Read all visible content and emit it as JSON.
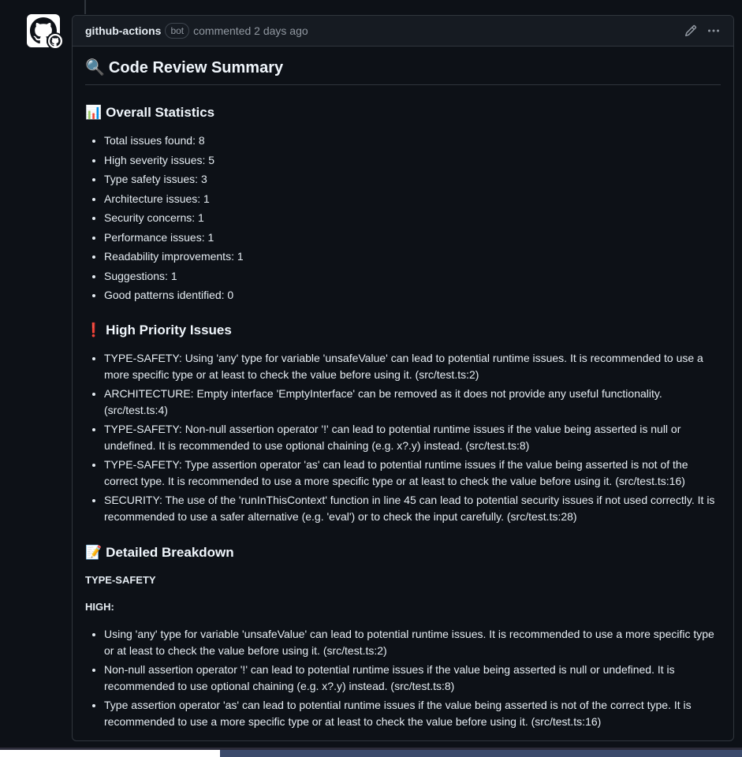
{
  "header": {
    "author": "github-actions",
    "bot_label": "bot",
    "meta": "commented 2 days ago"
  },
  "summary": {
    "title": "Code Review Summary",
    "title_icon": "🔍",
    "stats_heading": "Overall Statistics",
    "stats_icon": "📊",
    "stats": [
      "Total issues found: 8",
      "High severity issues: 5",
      "Type safety issues: 3",
      "Architecture issues: 1",
      "Security concerns: 1",
      "Performance issues: 1",
      "Readability improvements: 1",
      "Suggestions: 1",
      "Good patterns identified: 0"
    ],
    "priority_heading": "High Priority Issues",
    "priority_icon": "❗",
    "priority_issues": [
      "TYPE-SAFETY: Using 'any' type for variable 'unsafeValue' can lead to potential runtime issues. It is recommended to use a more specific type or at least to check the value before using it. (src/test.ts:2)",
      "ARCHITECTURE: Empty interface 'EmptyInterface' can be removed as it does not provide any useful functionality. (src/test.ts:4)",
      "TYPE-SAFETY: Non-null assertion operator '!' can lead to potential runtime issues if the value being asserted is null or undefined. It is recommended to use optional chaining (e.g. x?.y) instead. (src/test.ts:8)",
      "TYPE-SAFETY: Type assertion operator 'as' can lead to potential runtime issues if the value being asserted is not of the correct type. It is recommended to use a more specific type or at least to check the value before using it. (src/test.ts:16)",
      "SECURITY: The use of the 'runInThisContext' function in line 45 can lead to potential security issues if not used correctly. It is recommended to use a safer alternative (e.g. 'eval') or to check the input carefully. (src/test.ts:28)"
    ],
    "breakdown_heading": "Detailed Breakdown",
    "breakdown_icon": "📝",
    "category": "TYPE-SAFETY",
    "severity": "HIGH:",
    "breakdown_items": [
      "Using 'any' type for variable 'unsafeValue' can lead to potential runtime issues. It is recommended to use a more specific type or at least to check the value before using it. (src/test.ts:2)",
      "Non-null assertion operator '!' can lead to potential runtime issues if the value being asserted is null or undefined. It is recommended to use optional chaining (e.g. x?.y) instead. (src/test.ts:8)",
      "Type assertion operator 'as' can lead to potential runtime issues if the value being asserted is not of the correct type. It is recommended to use a more specific type or at least to check the value before using it. (src/test.ts:16)"
    ]
  },
  "icons": {
    "avatar": "github-octocat-icon",
    "edit": "pencil-icon",
    "more": "kebab-horizontal-icon"
  }
}
